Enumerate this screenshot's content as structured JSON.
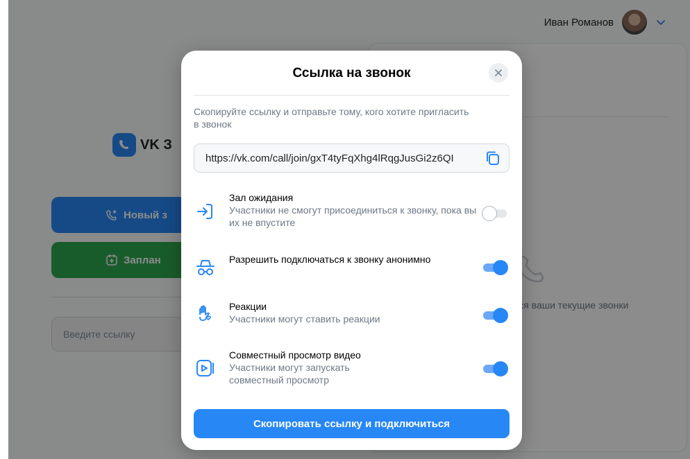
{
  "header": {
    "user_name": "Иван Романов"
  },
  "background": {
    "logo_text": "VK З",
    "new_call_label": "Новый з",
    "schedule_label": "Заплан",
    "link_placeholder": "Введите ссылку",
    "hint_text": "ься ваши текущие звонки"
  },
  "modal": {
    "title": "Ссылка на звонок",
    "description": "Скопируйте ссылку и отправьте тому, кого хотите пригласить в звонок",
    "link": "https://vk.com/call/join/gxT4tyFqXhg4lRqgJusGi2z6QI",
    "options": [
      {
        "title": "Зал ожидания",
        "subtitle": "Участники не смогут присоединиться к звонку, пока вы их не впустите",
        "enabled": false,
        "icon": "enter-icon"
      },
      {
        "title": "Разрешить подключаться к звонку анонимно",
        "subtitle": "",
        "enabled": true,
        "icon": "incognito-icon"
      },
      {
        "title": "Реакции",
        "subtitle": "Участники могут ставить реакции",
        "enabled": true,
        "icon": "hand-heart-icon"
      },
      {
        "title": "Совместный просмотр видео",
        "subtitle": "Участники могут запускать совместный просмотр",
        "enabled": true,
        "icon": "play-icon"
      }
    ],
    "submit_label": "Скопировать ссылку и подключиться"
  },
  "colors": {
    "accent": "#2787f5",
    "green": "#2fa84f",
    "overlay": "rgba(0,0,0,0.45)"
  }
}
